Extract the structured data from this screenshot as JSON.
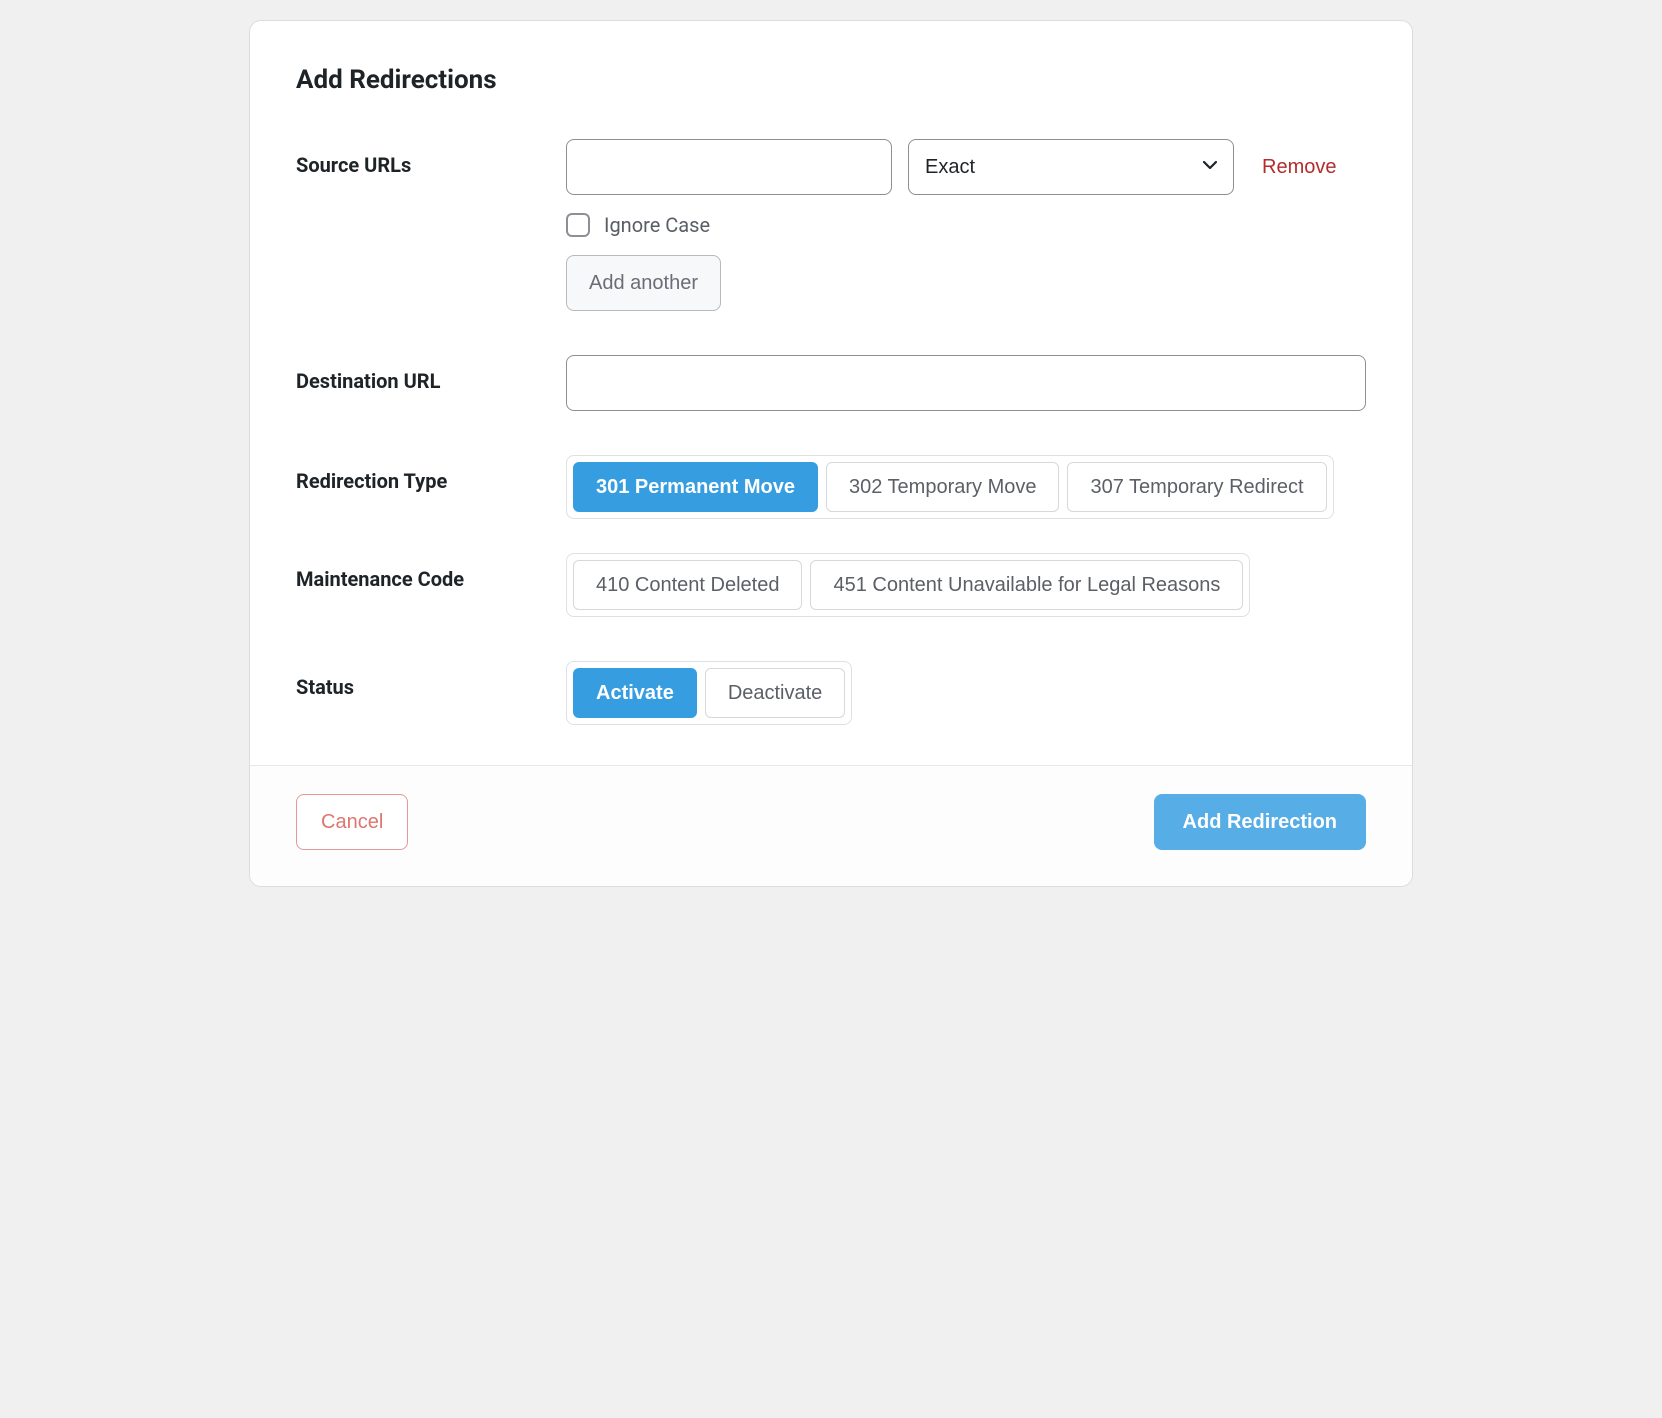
{
  "title": "Add Redirections",
  "labels": {
    "source": "Source URLs",
    "destination": "Destination URL",
    "type": "Redirection Type",
    "maintenance": "Maintenance Code",
    "status": "Status"
  },
  "source": {
    "value": "",
    "match_selected": "Exact",
    "remove": "Remove",
    "ignore_case_label": "Ignore Case",
    "ignore_case_checked": false,
    "add_another": "Add another"
  },
  "destination": {
    "value": ""
  },
  "type_options": [
    {
      "label": "301 Permanent Move",
      "selected": true
    },
    {
      "label": "302 Temporary Move",
      "selected": false
    },
    {
      "label": "307 Temporary Redirect",
      "selected": false
    }
  ],
  "maintenance_options": [
    {
      "label": "410 Content Deleted",
      "selected": false
    },
    {
      "label": "451 Content Unavailable for Legal Reasons",
      "selected": false
    }
  ],
  "status_options": [
    {
      "label": "Activate",
      "selected": true
    },
    {
      "label": "Deactivate",
      "selected": false
    }
  ],
  "actions": {
    "cancel": "Cancel",
    "submit": "Add Redirection"
  }
}
